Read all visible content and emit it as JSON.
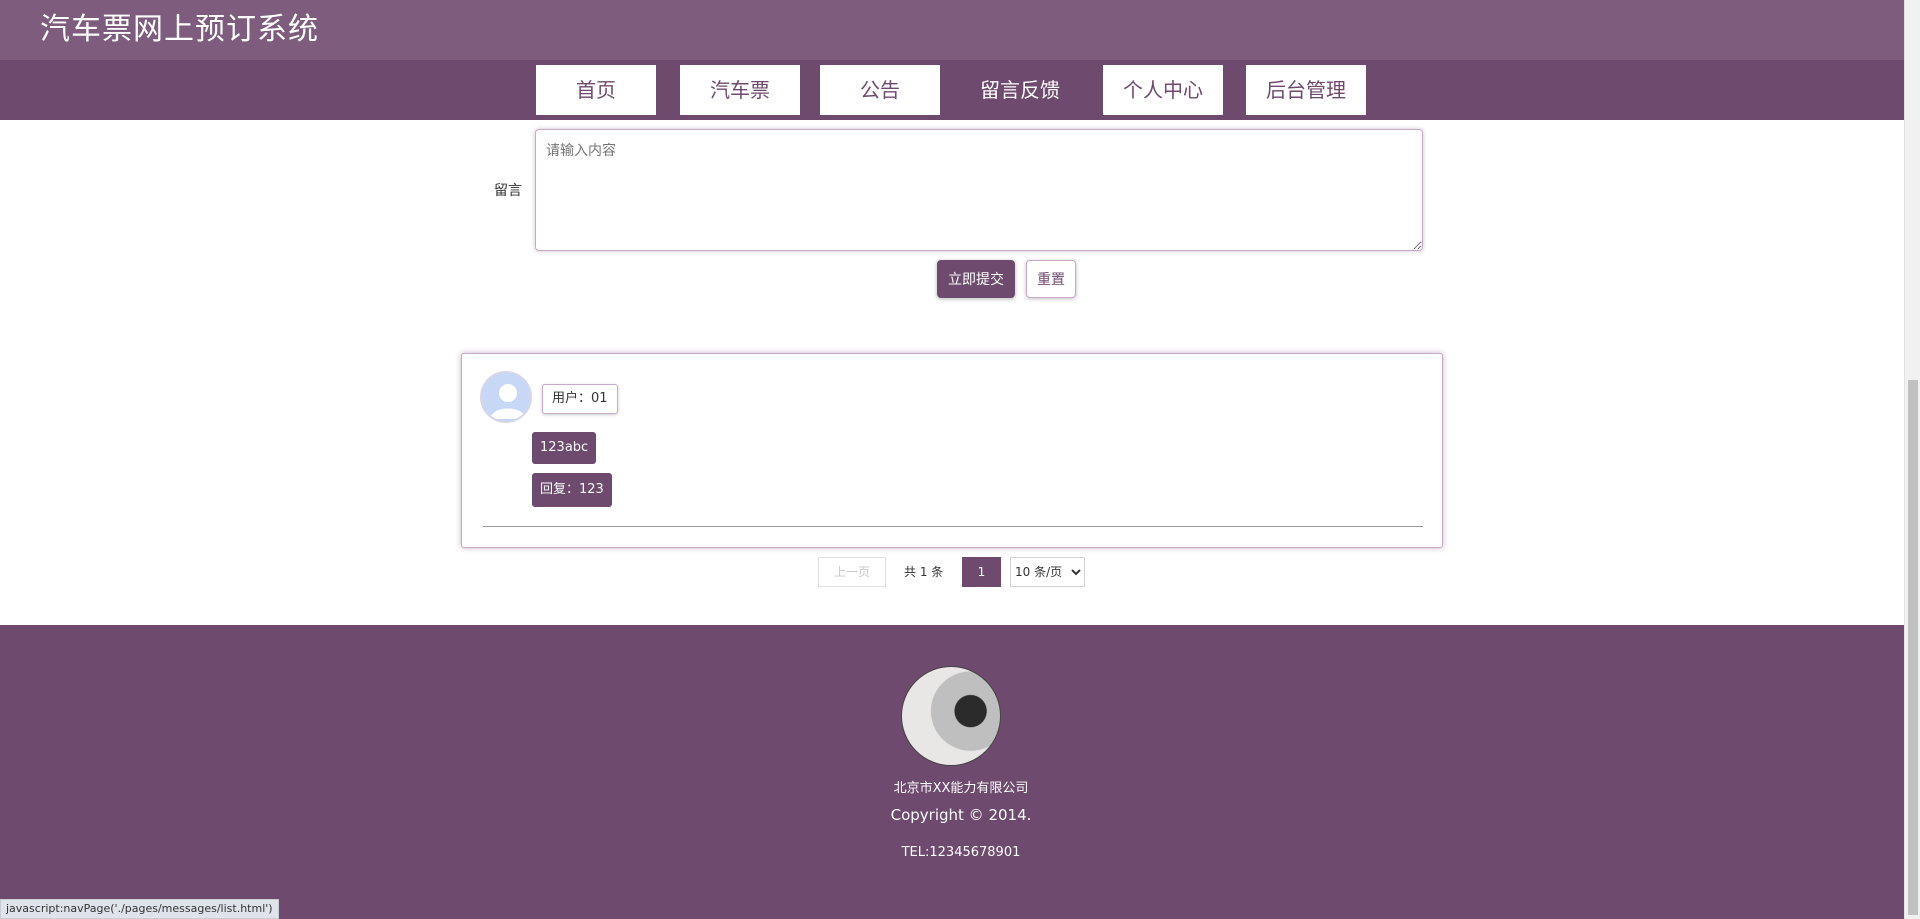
{
  "header": {
    "site_title": "汽车票网上预订系统"
  },
  "nav": {
    "items": [
      {
        "label": "首页"
      },
      {
        "label": "汽车票"
      },
      {
        "label": "公告"
      },
      {
        "label": "留言反馈",
        "active": true
      },
      {
        "label": "个人中心"
      },
      {
        "label": "后台管理"
      }
    ]
  },
  "form": {
    "message_label": "留言",
    "message_placeholder": "请输入内容",
    "message_value": "",
    "submit_label": "立即提交",
    "reset_label": "重置"
  },
  "comments": [
    {
      "user": "用户：01",
      "content": "123abc",
      "reply": "回复：123"
    }
  ],
  "pagination": {
    "prev_label": "上一页",
    "total_text": "共 1 条",
    "current_page": "1",
    "page_size_selected": "10 条/页"
  },
  "footer": {
    "company": "北京市XX能力有限公司",
    "copyright": "Copyright © 2014.",
    "tel": "TEL:12345678901"
  },
  "status_bar": {
    "text": "javascript:navPage('./pages/messages/list.html')"
  },
  "colors": {
    "primary": "#6d4a6e",
    "header": "#7e5c7e"
  }
}
